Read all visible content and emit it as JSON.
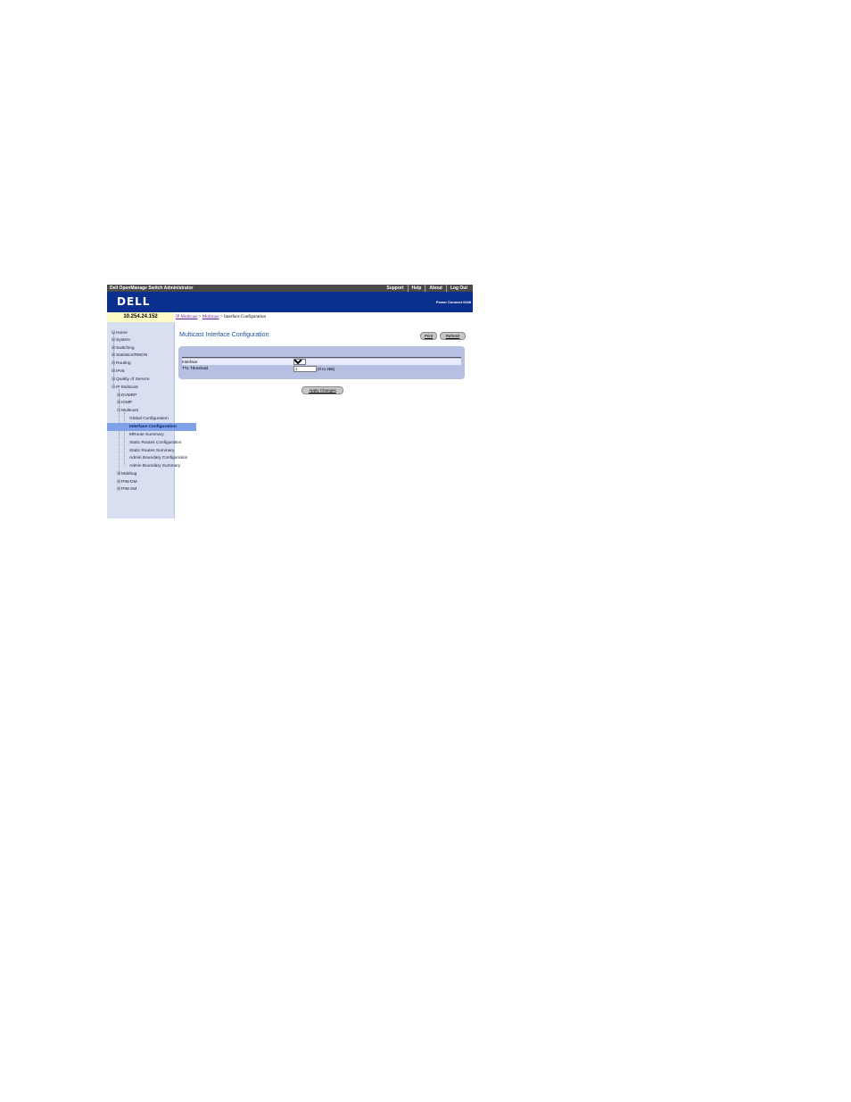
{
  "topbar": {
    "title": "Dell OpenManage Switch Administrator",
    "links": [
      "Support",
      "Help",
      "About",
      "Log Out"
    ]
  },
  "banner": {
    "logo": "DELL",
    "product": "Power Connect 6248"
  },
  "ip_address": "10.254.24.152",
  "breadcrumb": {
    "part1": "IP Multicast",
    "sep1": " > ",
    "part2": "Multicast",
    "sep2": " > ",
    "current": "Interface Configuration"
  },
  "nav": {
    "items": [
      {
        "label": "Home",
        "pm": "⊟"
      },
      {
        "label": "System",
        "pm": "⊞"
      },
      {
        "label": "Switching",
        "pm": "⊞"
      },
      {
        "label": "Statistics/RMON",
        "pm": "⊞"
      },
      {
        "label": "Routing",
        "pm": "⊞"
      },
      {
        "label": "IPv6",
        "pm": "⊞"
      },
      {
        "label": "Quality of Service",
        "pm": "⊞"
      },
      {
        "label": "IP Multicast",
        "pm": "⊟"
      },
      {
        "label": "DVMRP",
        "pm": "⊞"
      },
      {
        "label": "IGMP",
        "pm": "⊞"
      },
      {
        "label": "Multicast",
        "pm": "⊟"
      },
      {
        "label": "Global Configuration",
        "pm": ""
      },
      {
        "label": "Interface Configuration",
        "pm": ""
      },
      {
        "label": "MRoute Summary",
        "pm": ""
      },
      {
        "label": "Static Routes Configuration",
        "pm": ""
      },
      {
        "label": "Static Routes Summary",
        "pm": ""
      },
      {
        "label": "Admin Boundary Configuration",
        "pm": ""
      },
      {
        "label": "Admin Boundary Summary",
        "pm": ""
      },
      {
        "label": "Mdebug",
        "pm": "⊞"
      },
      {
        "label": "PIM-DM",
        "pm": "⊞"
      },
      {
        "label": "PIM-SM",
        "pm": "⊞"
      }
    ],
    "selected_label": "Interface Configuration"
  },
  "page": {
    "title": "Multicast Interface Configuration",
    "print_label": "Print",
    "refresh_label": "Refresh",
    "interface_label": "Interface",
    "interface_value": "",
    "ttl_label": "TTL Threshold",
    "ttl_value": "1",
    "ttl_range": "(0 to 255)",
    "apply_label": "Apply Changes"
  },
  "colors": {
    "banner": "#0a2f8c",
    "topbar": "#4a4a4a",
    "nav_bg": "#d8dff0",
    "selected": "#7fa1e8",
    "form_bg": "#b7bfe3",
    "title": "#1c4fa5"
  }
}
